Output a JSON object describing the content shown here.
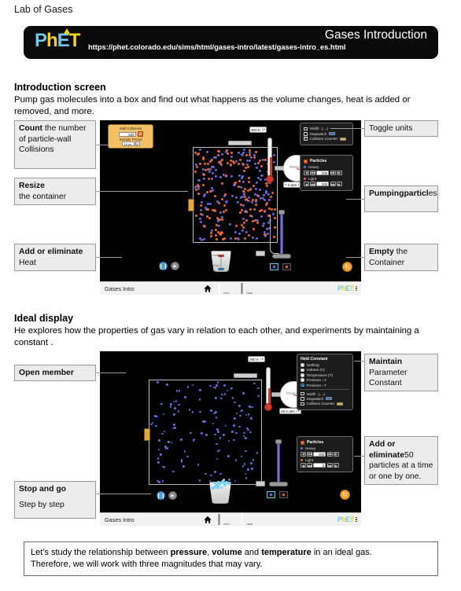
{
  "document": {
    "title": "Lab of Gases"
  },
  "banner": {
    "logo": "PhET",
    "sim_title": "Gases Introduction",
    "url": "https://phet.colorado.edu/sims/html/gases-intro/latest/gases-intro_es.html"
  },
  "section1": {
    "heading": "Introduction screen",
    "body": "Pump gas molecules into a box and find out what happens as the volume changes, heat is added or removed, and more.",
    "callouts_left": [
      {
        "id": "count-collisions",
        "bold": "Count",
        "rest": " the number of particle-wall Collisions"
      },
      {
        "id": "resize-container",
        "bold": "Resize",
        "rest": "the container"
      },
      {
        "id": "add-remove-heat",
        "bold": "Add or eliminate",
        "rest": " Heat"
      }
    ],
    "callouts_right": [
      {
        "id": "toggle-units",
        "bold": "",
        "rest": "Toggle units"
      },
      {
        "id": "pumping-particles",
        "bold": "Pumpingparticl",
        "rest": "es"
      },
      {
        "id": "empty-container",
        "bold": "Empty",
        "rest": " the Container"
      }
    ],
    "sim": {
      "collision_counter": {
        "title": "Wall Collisions",
        "count": "620",
        "reset_icon": "reset-icon",
        "sample_label": "Sample Period",
        "sample_value": "10 ps"
      },
      "thermometer": {
        "value": "300 K"
      },
      "gauge": {
        "label": "Pressure",
        "value": "7.0 atm"
      },
      "panel": {
        "checkboxes": [
          {
            "label": "Width",
            "checked": false,
            "icon": "width-arrow-icon"
          },
          {
            "label": "Stopwatch",
            "checked": false,
            "icon": "stopwatch-swatch"
          },
          {
            "label": "Collision Counter",
            "checked": true,
            "icon": "counter-swatch"
          }
        ],
        "particles_title": "Particles",
        "heavy_label": "Heavy",
        "heavy_value": "200",
        "light_label": "Light",
        "light_value": "200"
      },
      "bucket": {
        "hot": "Heat",
        "cold": "Cool"
      },
      "nav": {
        "title": "Gases Intro",
        "home": "home-icon",
        "tabs": [
          "Intro",
          "Laws"
        ],
        "selected_tab": "Intro",
        "logo": "PhET"
      }
    }
  },
  "section2": {
    "heading": "Ideal display",
    "body": "He explores how the properties of gas vary in relation to each other, and experiments by maintaining a constant .",
    "callouts_left": [
      {
        "id": "open-member",
        "bold": "Open member",
        "rest": ""
      },
      {
        "id": "stop-and-go",
        "bold": "Stop and go",
        "rest": ""
      },
      {
        "id": "step-by-step",
        "bold": "",
        "rest": "Step by step"
      }
    ],
    "callouts_right": [
      {
        "id": "maintain-parameter-constant",
        "bold": "Maintain",
        "rest": "Parameter Constant"
      },
      {
        "id": "add-remove-particles",
        "bold": "Add or eliminate",
        "rest": "50 particles at a time or one by one."
      }
    ],
    "sim": {
      "thermometer": {
        "value": "290 K"
      },
      "gauge": {
        "label": "Pressure",
        "value": "29.2 atm"
      },
      "panel": {
        "held_constant_title": "Held Constant",
        "radios": [
          {
            "label": "Nothing",
            "selected": false
          },
          {
            "label": "Volume (V)",
            "selected": false
          },
          {
            "label": "Temperature (T)",
            "selected": false
          },
          {
            "label": "Pressure ↓V",
            "selected": false
          },
          {
            "label": "Pressure ↓T",
            "selected": true
          }
        ],
        "checkboxes": [
          {
            "label": "Width",
            "checked": false
          },
          {
            "label": "Stopwatch",
            "checked": false
          },
          {
            "label": "Collision Counter",
            "checked": false
          }
        ],
        "particles_title": "Particles",
        "heavy_label": "Heavy",
        "heavy_value": "300",
        "light_label": "Light",
        "light_value": "0"
      },
      "nav": {
        "title": "Gases Intro",
        "home": "home-icon",
        "tabs": [
          "Intro",
          "Laws"
        ],
        "selected_tab": "Laws",
        "logo": "PhET"
      }
    }
  },
  "note": {
    "line1_a": "Let's study the relationship between ",
    "line1_b1": "pressure",
    "line1_c": ", ",
    "line1_b2": "volume",
    "line1_d": " and ",
    "line1_b3": "temperature",
    "line1_e": " in an ideal gas.",
    "line2": "Therefore, we will work with three magnitudes that may vary."
  },
  "colors": {
    "heavy_particle": "#6f6fe8",
    "light_particle": "#e8663a",
    "panel_bg": "#1c1c1c",
    "accent_orange": "#f0a030",
    "counter_yellow": "#f3c066"
  }
}
